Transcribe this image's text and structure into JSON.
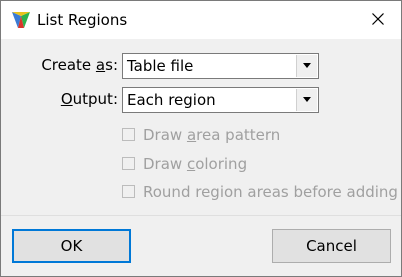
{
  "window": {
    "title": "List Regions"
  },
  "form": {
    "create_as": {
      "label_before": "Create ",
      "label_mnemonic": "a",
      "label_after": "s:",
      "value": "Table file"
    },
    "output": {
      "label_mnemonic": "O",
      "label_after": "utput:",
      "value": "Each region"
    },
    "checkboxes": [
      {
        "label_before": "Draw ",
        "label_mnemonic": "a",
        "label_after": "rea pattern",
        "checked": false,
        "enabled": false
      },
      {
        "label_before": "Draw ",
        "label_mnemonic": "c",
        "label_after": "oloring",
        "checked": false,
        "enabled": false
      },
      {
        "label_before": "Round region areas before adding",
        "label_mnemonic": "",
        "label_after": "",
        "checked": false,
        "enabled": false
      }
    ]
  },
  "buttons": {
    "ok": "OK",
    "cancel": "Cancel"
  },
  "icons": {
    "app": "app-logo-icon",
    "close": "close-icon",
    "dropdown": "chevron-down-icon"
  },
  "colors": {
    "focus_border": "#0078d7",
    "disabled_text": "#a0a0a0",
    "dialog_bg": "#f0f0f0"
  }
}
